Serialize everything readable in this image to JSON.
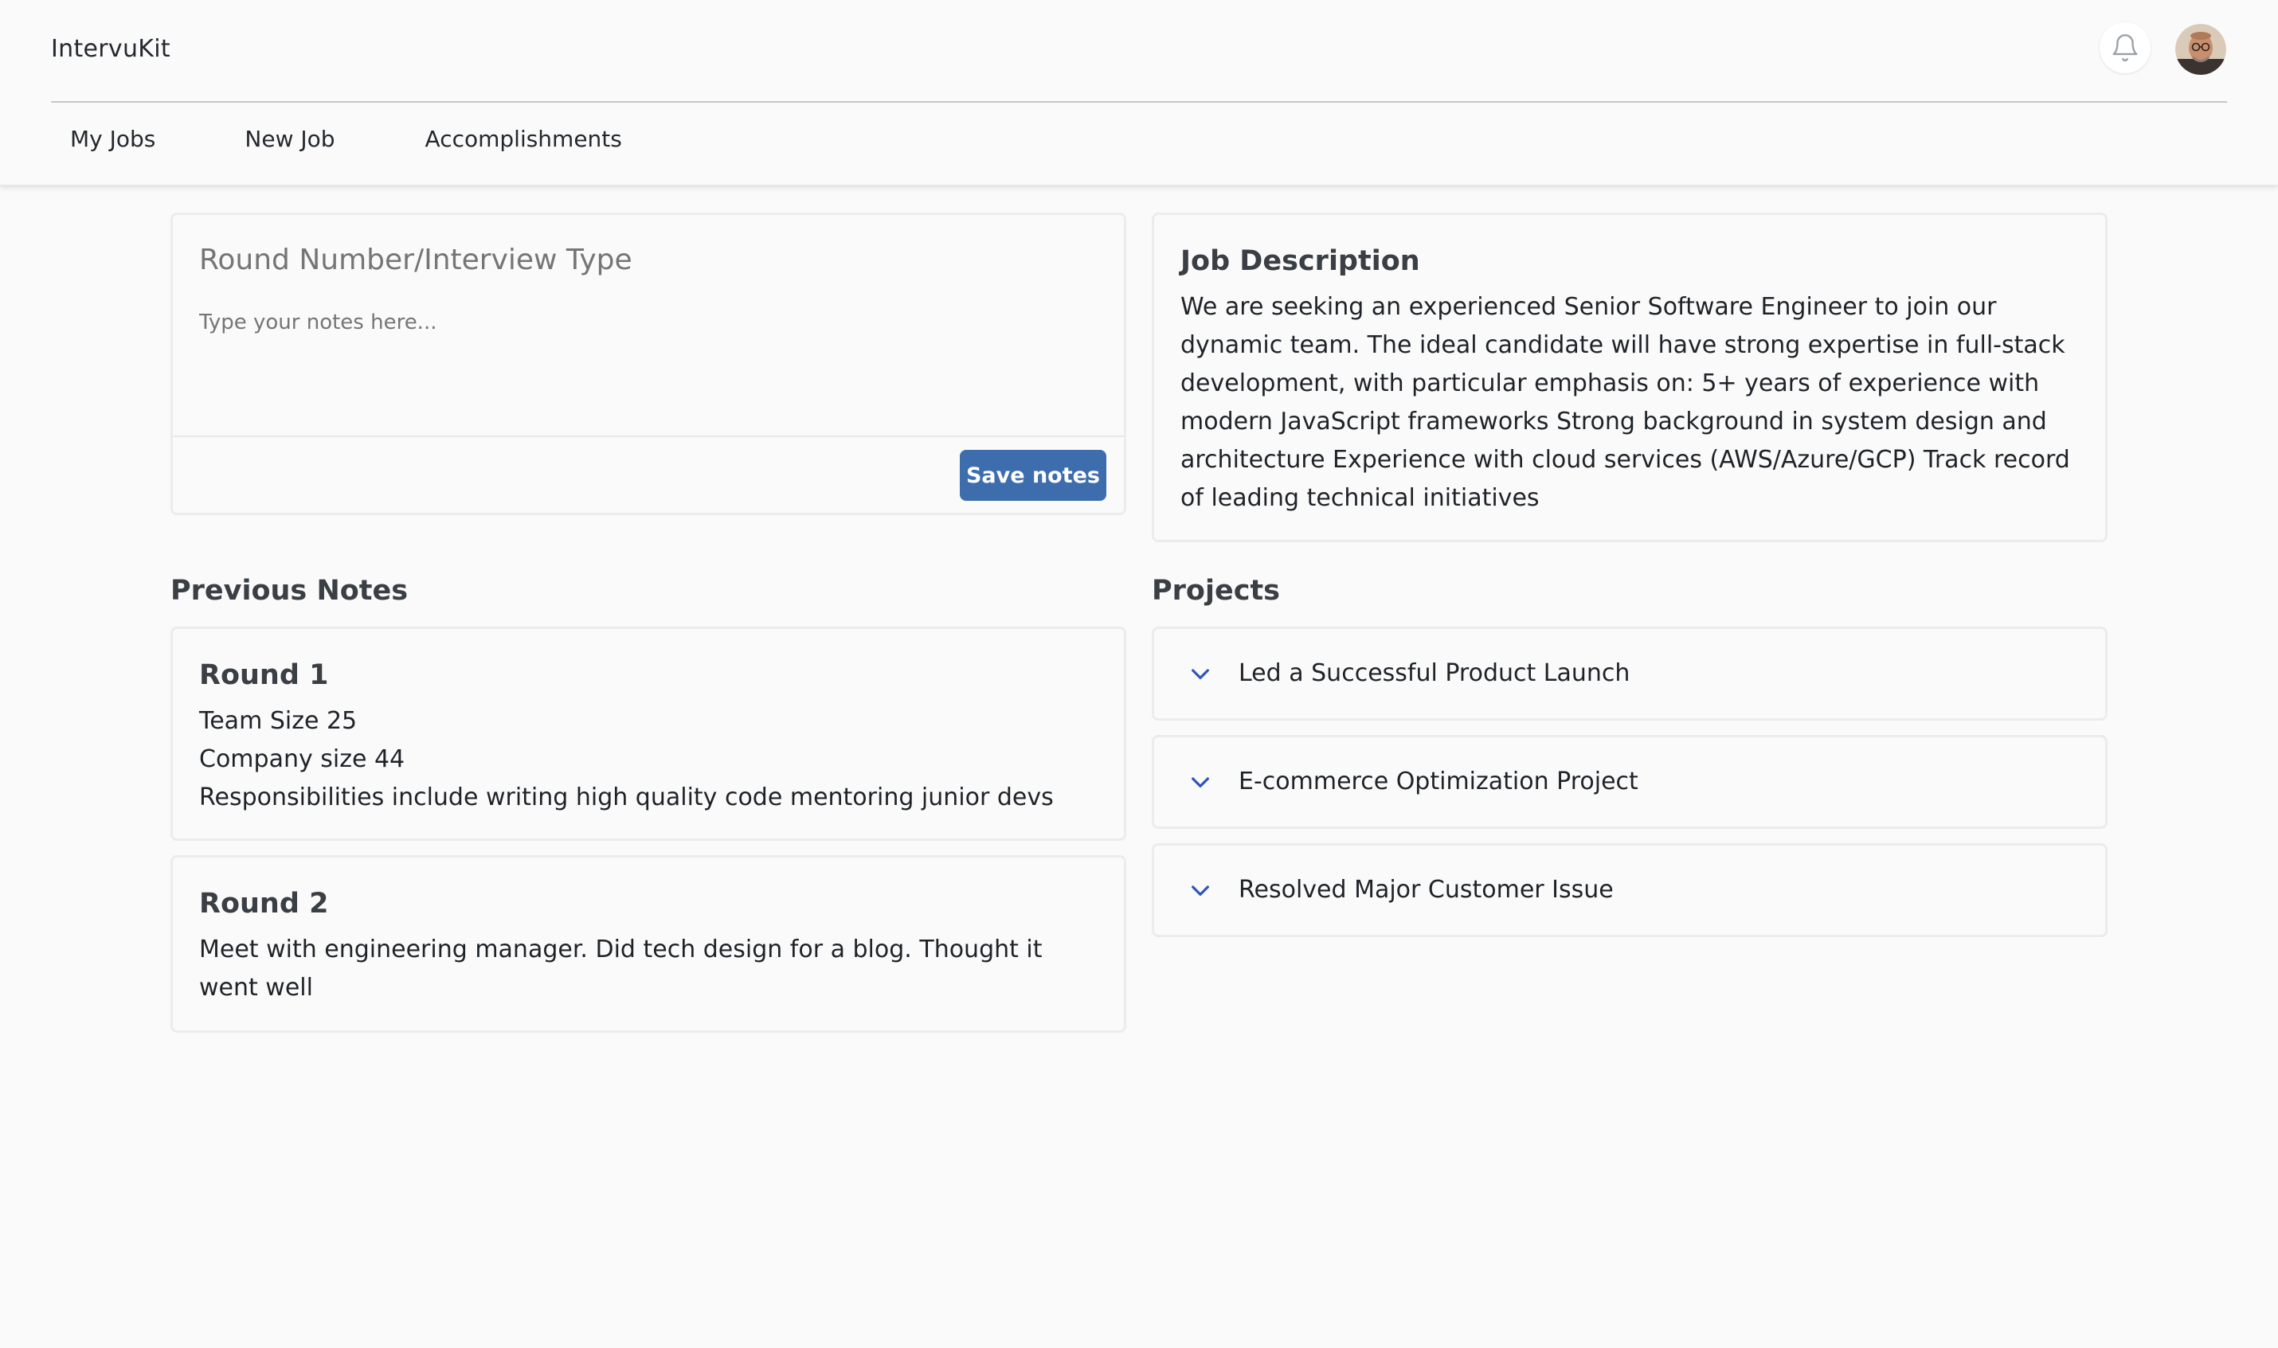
{
  "app": {
    "name": "IntervuKit"
  },
  "header": {
    "icons": {
      "notifications": "bell-icon",
      "profile": "user-avatar"
    }
  },
  "nav": {
    "items": [
      {
        "label": "My Jobs"
      },
      {
        "label": "New Job"
      },
      {
        "label": "Accomplishments"
      }
    ]
  },
  "notes_editor": {
    "title_placeholder": "Round Number/Interview Type",
    "body_placeholder": "Type your notes here...",
    "save_label": "Save notes"
  },
  "job_description": {
    "heading": "Job Description",
    "text": "We are seeking an experienced Senior Software Engineer to join our dynamic team. The ideal candidate will have strong expertise in full-stack development, with particular emphasis on: 5+ years of experience with modern JavaScript frameworks Strong background in system design and architecture Experience with cloud services (AWS/Azure/GCP) Track record of leading technical initiatives"
  },
  "previous_notes": {
    "heading": "Previous Notes",
    "items": [
      {
        "title": "Round 1",
        "lines": [
          "Team Size 25",
          "Company size 44",
          "Responsibilities include writing high quality code mentoring junior devs"
        ]
      },
      {
        "title": "Round 2",
        "lines": [
          "Meet with engineering manager. Did tech design for a blog. Thought it went well"
        ]
      }
    ]
  },
  "projects": {
    "heading": "Projects",
    "items": [
      {
        "label": "Led a Successful Product Launch"
      },
      {
        "label": "E-commerce Optimization Project"
      },
      {
        "label": "Resolved Major Customer Issue"
      }
    ]
  },
  "colors": {
    "accent": "#3d6dad",
    "chevron": "#2f55b8",
    "background": "#fafafa",
    "card_border": "#ececec"
  }
}
